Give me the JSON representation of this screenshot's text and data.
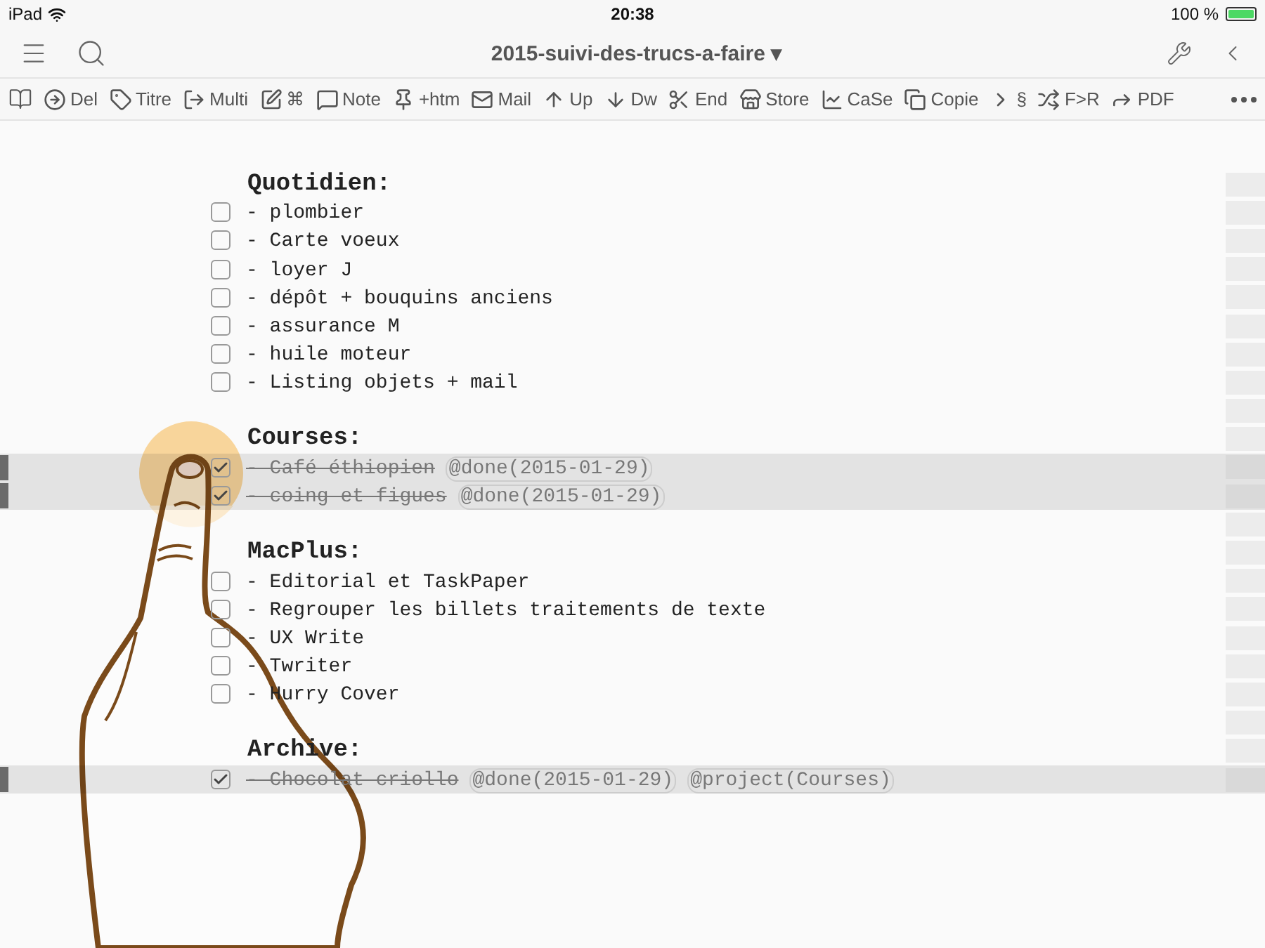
{
  "status_bar": {
    "device": "iPad",
    "time": "20:38",
    "battery": "100 %"
  },
  "nav_bar": {
    "title": "2015-suivi-des-trucs-a-faire",
    "title_caret": "▾"
  },
  "toolbar": {
    "buttons": [
      "Del",
      "Titre",
      "Multi",
      "⌘",
      "Note",
      "+htm",
      "Mail",
      "Up",
      "Dw",
      "End",
      "Store",
      "CaSe",
      "Copie",
      "§",
      "F>R",
      "PDF"
    ]
  },
  "sections": [
    {
      "title": "Quotidien:",
      "items": [
        {
          "text": "- plombier",
          "checked": false,
          "selected": false
        },
        {
          "text": "- Carte voeux",
          "checked": false,
          "selected": false
        },
        {
          "text": "- loyer J",
          "checked": false,
          "selected": false
        },
        {
          "text": "- dépôt + bouquins anciens",
          "checked": false,
          "selected": false
        },
        {
          "text": "- assurance M",
          "checked": false,
          "selected": false
        },
        {
          "text": "- huile moteur",
          "checked": false,
          "selected": false
        },
        {
          "text": "- Listing objets + mail",
          "checked": false,
          "selected": false
        }
      ]
    },
    {
      "title": "Courses:",
      "items": [
        {
          "text": "- Café éthiopien",
          "tags": [
            "@done(2015-01-29)"
          ],
          "checked": true,
          "selected": true
        },
        {
          "text": "- coing et figues",
          "tags": [
            "@done(2015-01-29)"
          ],
          "checked": true,
          "selected": true
        }
      ]
    },
    {
      "title": "MacPlus:",
      "items": [
        {
          "text": "- Editorial et TaskPaper",
          "checked": false,
          "selected": false
        },
        {
          "text": "- Regrouper les billets traitements de texte",
          "checked": false,
          "selected": false
        },
        {
          "text": "- UX Write",
          "checked": false,
          "selected": false
        },
        {
          "text": "- Twriter",
          "checked": false,
          "selected": false
        },
        {
          "text": "- Hurry Cover",
          "checked": false,
          "selected": false
        }
      ]
    },
    {
      "title": "Archive:",
      "items": [
        {
          "text": "- Chocolat criollo",
          "tags": [
            "@done(2015-01-29)",
            "@project(Courses)"
          ],
          "checked": true,
          "selected": true
        }
      ]
    }
  ]
}
